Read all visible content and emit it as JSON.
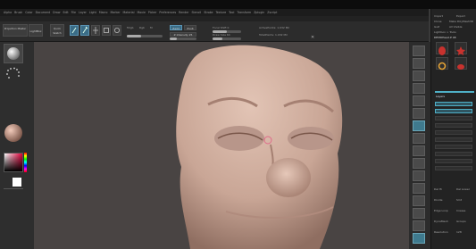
{
  "app": {
    "menu": [
      "Alpha",
      "Brush",
      "Color",
      "Document",
      "Draw",
      "Edit",
      "File",
      "Layer",
      "Light",
      "Macro",
      "Marker",
      "Material",
      "Movie",
      "Picker",
      "Preferences",
      "Render",
      "Stencil",
      "Stroke",
      "Texture",
      "Tool",
      "Transform",
      "Zplugin",
      "Zscript"
    ],
    "info_line": ""
  },
  "toolbar": {
    "projection_master": "Projection Master",
    "lightbox": "LightBox",
    "quick_sketch": "Quick Sketch",
    "edit": "Edit",
    "draw": "Draw",
    "move": "Move",
    "scale": "Scale",
    "rotate": "Rotate",
    "mrgb": "Mrgb",
    "rgb": "Rgb",
    "m": "M",
    "zadd": "Zadd",
    "zsub": "Zsub",
    "focal_shift": "Focal Shift 0",
    "draw_size": "Draw Size 64",
    "z_intensity": "Z Intensity 25",
    "active_points": "ActivePoints: 1.032 Mil",
    "total_points": "TotalPoints: 1.032 Mil",
    "rgb_intensity_level": 0.4,
    "focal_level": 0.5,
    "draw_size_level": 0.35,
    "z_intensity_level": 0.25
  },
  "left_shelf": {
    "brush_label": "",
    "stroke_label": "",
    "material_label": "",
    "color_label": ""
  },
  "right_shelf": {
    "buttons": 16
  },
  "tray": {
    "header_left": "Import",
    "header_right": "Export",
    "row1_left": "Clone",
    "row1_right": "Make PolyMesh3D",
    "row2_left": "GoZ",
    "row2_right": "All Visible",
    "lightbox_label": "Lightbox > Tools",
    "tool_name": "DEMOHead.P 48",
    "subtools": [
      "DEMOHead",
      "Polymesh3D",
      "SimpleBrush",
      "EraserBrush"
    ],
    "layers_label": "Layers",
    "bottom_items": [
      "Geometry",
      "Masking",
      "Visibility",
      "Polygroups",
      "Contact",
      "Morph Target",
      "Polypaint",
      "UV Map"
    ],
    "lower_rows": [
      {
        "left": "Del Hi",
        "right": "Del Lower"
      },
      {
        "left": "Divide",
        "right": "Smt"
      },
      {
        "left": "Edge Loop",
        "right": "Crease"
      },
      {
        "left": "DynaMesh",
        "right": "Groups"
      },
      {
        "left": "Resolution",
        "right": "128"
      }
    ]
  },
  "viewport": {
    "model": "sculpted head"
  }
}
